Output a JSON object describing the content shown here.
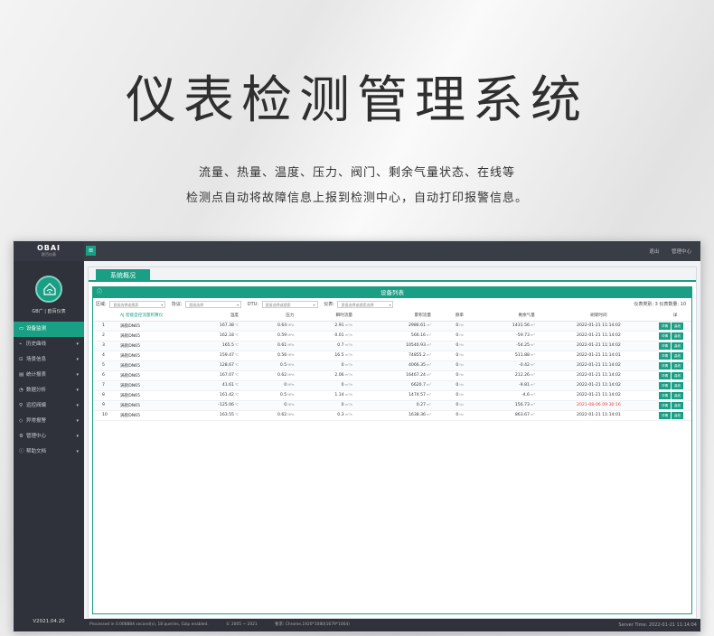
{
  "hero": {
    "title": "仪表检测管理系统",
    "line1": "流量、热量、温度、压力、阀门、剩余气量状态、在线等",
    "line2": "检测点自动将故障信息上报到检测中心，自动打印报警信息。"
  },
  "app": {
    "logo": "OBAI",
    "logo_sub": "欧百仪表",
    "user_label": "GB广 | 欧百仪表",
    "version": "V2021.04.20",
    "top_links": [
      "退出",
      "管理中心"
    ],
    "nav": [
      {
        "label": "设备监测",
        "icon": "monitor-icon",
        "active": true
      },
      {
        "label": "历史曲线",
        "icon": "chart-icon"
      },
      {
        "label": "场景信息",
        "icon": "scene-icon"
      },
      {
        "label": "统计报表",
        "icon": "report-icon"
      },
      {
        "label": "数据分析",
        "icon": "analysis-icon"
      },
      {
        "label": "远控阀编",
        "icon": "valve-icon"
      },
      {
        "label": "异常报警",
        "icon": "alarm-icon"
      },
      {
        "label": "管理中心",
        "icon": "settings-icon"
      },
      {
        "label": "帮助文档",
        "icon": "help-icon"
      }
    ],
    "tab": "系统概况",
    "panel_title": "设备列表",
    "filters": {
      "area_label": "区域:",
      "area_value": "直接选择或搜索",
      "protocol_label": "协议:",
      "protocol_value": "直接选择",
      "dtu_label": "DTU:",
      "dtu_value": "直接选择或搜索",
      "meter_label": "仪表:",
      "meter_value": "直接选择或搜索选择",
      "counts": "仪表类别: 3  仪表数量: 10"
    },
    "columns": [
      "AJ 智能自控流量积算仪",
      "温度",
      "压力",
      "瞬时流量",
      "累积流量",
      "频率",
      "剩余气量",
      "刷新时间",
      "详"
    ],
    "rows": [
      {
        "idx": "1",
        "name": "涡街DN65",
        "temp": "167.38",
        "press": "0.64",
        "flow": "2.91",
        "total": "2986.61",
        "freq": "0",
        "remain": "1431.56",
        "time": "2022-01-21 11:14:02",
        "alert": false
      },
      {
        "idx": "2",
        "name": "涡街DN65",
        "temp": "162.18",
        "press": "0.59",
        "flow": "0.01",
        "total": "566.16",
        "freq": "0",
        "remain": "-59.73",
        "time": "2022-01-21 11:14:02",
        "alert": false
      },
      {
        "idx": "3",
        "name": "涡街DN65",
        "temp": "165.5",
        "press": "0.61",
        "flow": "0.7",
        "total": "10540.93",
        "freq": "0",
        "remain": "-54.25",
        "time": "2022-01-21 11:14:02",
        "alert": false
      },
      {
        "idx": "4",
        "name": "涡街DN65",
        "temp": "159.47",
        "press": "0.56",
        "flow": "16.5",
        "total": "74855.2",
        "freq": "0",
        "remain": "511.88",
        "time": "2022-01-21 11:14:01",
        "alert": false
      },
      {
        "idx": "5",
        "name": "涡街DN65",
        "temp": "128.67",
        "press": "0.5",
        "flow": "0",
        "total": "4066.35",
        "freq": "0",
        "remain": "-0.42",
        "time": "2022-01-21 11:14:02",
        "alert": false
      },
      {
        "idx": "6",
        "name": "涡街DN65",
        "temp": "167.07",
        "press": "0.62",
        "flow": "2.06",
        "total": "16467.24",
        "freq": "0",
        "remain": "212.26",
        "time": "2022-01-21 11:14:02",
        "alert": false
      },
      {
        "idx": "7",
        "name": "涡街DN65",
        "temp": "41.61",
        "press": "0",
        "flow": "0",
        "total": "6620.7",
        "freq": "0",
        "remain": "-9.81",
        "time": "2022-01-21 11:14:02",
        "alert": false
      },
      {
        "idx": "8",
        "name": "涡街DN65",
        "temp": "161.42",
        "press": "0.5",
        "flow": "1.14",
        "total": "1474.57",
        "freq": "0",
        "remain": "-4.6",
        "time": "2022-01-21 11:14:02",
        "alert": false
      },
      {
        "idx": "9",
        "name": "涡街DN65",
        "temp": "-125.06",
        "press": "0",
        "flow": "0",
        "total": "0.27",
        "freq": "0",
        "remain": "156.73",
        "time": "2021-08-06 09:30:16",
        "alert": true
      },
      {
        "idx": "10",
        "name": "涡街DN65",
        "temp": "163.55",
        "press": "0.62",
        "flow": "0.3",
        "total": "1638.36",
        "freq": "0",
        "remain": "863.67",
        "time": "2022-01-21 11:14:01",
        "alert": false
      }
    ],
    "units": {
      "temp": "℃",
      "press": "MPa",
      "flow": "m³/h",
      "total": "m³",
      "freq": "Hz",
      "remain": "m³"
    },
    "buttons": {
      "detail": "详情",
      "curve": "曲线"
    },
    "footer": {
      "processed": "Processed in 0.008884 second(s), 18 queries, Gzip enabled.",
      "copyright": "© 2005 ~ 2021",
      "browser": "要求: Chrome,1920*1080(1679*1064)",
      "server_time": "Server Time: 2022-01-21 11:14:04"
    },
    "colors": {
      "accent": "#1a9e84",
      "sidebar": "#2f323a",
      "alert": "#e23b3b"
    }
  }
}
